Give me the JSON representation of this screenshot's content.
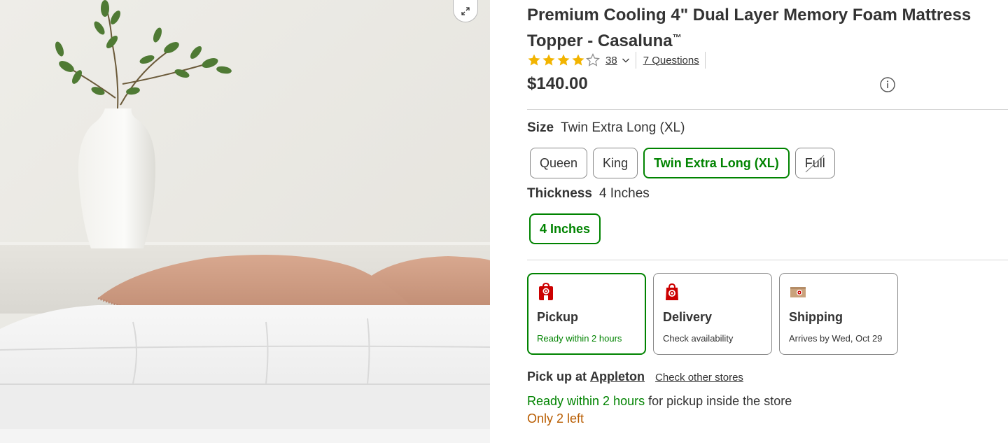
{
  "product": {
    "title": "Premium Cooling 4\" Dual Layer Memory Foam Mattress Topper - Casaluna",
    "trademark": "™",
    "rating_stars": 4.5,
    "rating_count": "38",
    "questions_link": "7 Questions",
    "price": "$140.00"
  },
  "image": {
    "expand_icon": "expand-icon",
    "alt_subject": "mattress-topper-with-pillows-and-vase"
  },
  "size": {
    "label": "Size",
    "selected": "Twin Extra Long (XL)",
    "options": [
      {
        "label": "Queen",
        "state": "available"
      },
      {
        "label": "King",
        "state": "available"
      },
      {
        "label": "Twin Extra Long (XL)",
        "state": "selected"
      },
      {
        "label": "Full",
        "state": "unavailable"
      }
    ]
  },
  "thickness": {
    "label": "Thickness",
    "selected": "4 Inches",
    "options": [
      {
        "label": "4 Inches",
        "state": "selected"
      }
    ]
  },
  "fulfillment": [
    {
      "title": "Pickup",
      "subtitle": "Ready within 2 hours",
      "icon": "store-pickup-icon",
      "selected": true
    },
    {
      "title": "Delivery",
      "subtitle": "Check availability",
      "icon": "delivery-bag-icon",
      "selected": false
    },
    {
      "title": "Shipping",
      "subtitle": "Arrives by Wed, Oct 29",
      "icon": "shipping-box-icon",
      "selected": false
    }
  ],
  "pickup": {
    "prefix": "Pick up at",
    "store": "Appleton",
    "check_other": "Check other stores",
    "ready_green": "Ready within 2 hours",
    "ready_rest": " for pickup inside the store",
    "stock": "Only 2 left"
  },
  "colors": {
    "accent_green": "#008300",
    "star_gold": "#f2b400",
    "stock_orange": "#b85c00",
    "target_red": "#cc0000"
  }
}
